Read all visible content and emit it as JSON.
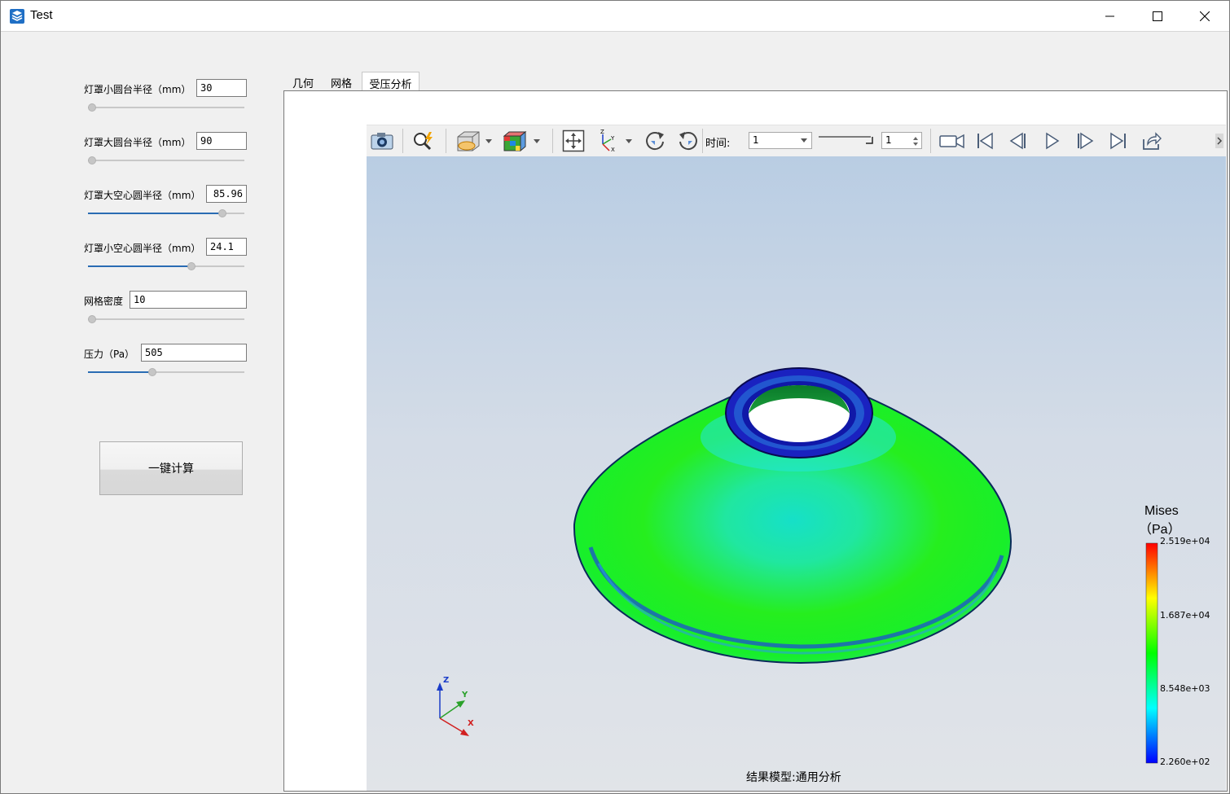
{
  "window": {
    "title": "Test"
  },
  "params": [
    {
      "label": "灯罩小圆台半径（mm）",
      "value": "30",
      "slider_fraction": 0.0
    },
    {
      "label": "灯罩大圆台半径（mm）",
      "value": "90",
      "slider_fraction": 0.0
    },
    {
      "label": "灯罩大空心圆半径（mm）",
      "value": "85.96",
      "slider_fraction": 0.86
    },
    {
      "label": "灯罩小空心圆半径（mm）",
      "value": "24.1",
      "slider_fraction": 0.66
    },
    {
      "label": "网格密度",
      "value": "10",
      "slider_fraction": 0.0
    },
    {
      "label": "压力（Pa）",
      "value": "505",
      "slider_fraction": 0.41
    }
  ],
  "calc_button": "一键计算",
  "tabs": [
    {
      "label": "几何",
      "active": false
    },
    {
      "label": "网格",
      "active": false
    },
    {
      "label": "受压分析",
      "active": true
    }
  ],
  "toolbar": {
    "time_label": "时间:",
    "time_value": "1",
    "step_value": "1",
    "icons": [
      "camera-icon",
      "query-icon",
      "clip-plane-icon",
      "display-mode-icon",
      "fit-view-icon",
      "axis-view-icon",
      "rotate-cw-icon",
      "rotate-ccw-icon",
      "record-video-icon",
      "first-frame-icon",
      "previous-frame-icon",
      "play-icon",
      "next-frame-icon",
      "last-frame-icon",
      "export-icon"
    ]
  },
  "legend": {
    "title_line1": "Mises",
    "title_line2": "（Pa）",
    "max": "2.519e+04",
    "mid_high": "1.687e+04",
    "mid_low": "8.548e+03",
    "min": "2.260e+02",
    "colors": [
      "#ff0000",
      "#ffff00",
      "#00ff00",
      "#00ffff",
      "#0000ff"
    ]
  },
  "axis_triad": {
    "x": "X",
    "y": "Y",
    "z": "Z"
  },
  "result_model": "结果模型:通用分析"
}
